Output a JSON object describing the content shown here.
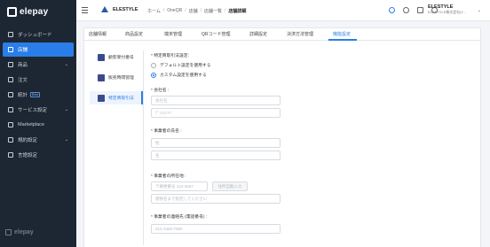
{
  "app": {
    "logo_text": "elepay"
  },
  "sidebar": {
    "items": [
      {
        "label": "ダッシュボード",
        "icon": "dashboard-icon"
      },
      {
        "label": "店舗",
        "icon": "store-icon",
        "active": true
      },
      {
        "label": "商品",
        "icon": "product-icon",
        "chevron": "⌄"
      },
      {
        "label": "注文",
        "icon": "order-icon"
      },
      {
        "label": "統計",
        "icon": "stats-icon",
        "badge": "Beta"
      },
      {
        "label": "サービス設定",
        "icon": "service-settings-icon",
        "chevron": "⌄"
      },
      {
        "label": "Marketplace",
        "icon": "marketplace-icon"
      },
      {
        "label": "規約設定",
        "icon": "terms-icon",
        "chevron": "⌄"
      },
      {
        "label": "言語設定",
        "icon": "language-icon"
      }
    ],
    "footer_text": "elepay"
  },
  "topbar": {
    "brand": "ELESTYLE",
    "breadcrumbs": [
      "ホーム",
      "OneQR",
      "店舗",
      "店舗一覧",
      "店舗詳細"
    ],
    "account_name": "ELESTYLE",
    "account_sub": "ELESTYLE株式会社(ﾃ..."
  },
  "tabs": [
    "店舗情報",
    "商品設定",
    "端末管理",
    "QRコード管理",
    "詳細設定",
    "決済方法管理",
    "機能設定"
  ],
  "active_tab": "機能設定",
  "subnav": [
    "顧客受付番号",
    "販売時間管理",
    "特定商取引法"
  ],
  "form": {
    "section_label": "* 特定商取引法設定:",
    "radio_default": "デフォルト設定を使用する",
    "radio_custom": "カスタム設定を使用する",
    "company_label": "* 会社名 :",
    "company_name_placeholder": "会社名",
    "company_kana_placeholder": "ﾃﾞﾌｫﾙﾄﾒｲ",
    "manager_label": "* 事業者の氏名 :",
    "last_name_placeholder": "姓",
    "first_name_placeholder": "名",
    "address_label": "* 事業者の所在地 :",
    "postal_placeholder": "〒郵便番号 123-4567",
    "auto_fill_button": "住所自動入力",
    "address_placeholder": "建物名まで指定してください",
    "phone_label": "* 事業者の連絡先 (電話番号) :",
    "phone_placeholder": "012-3456-7890"
  }
}
